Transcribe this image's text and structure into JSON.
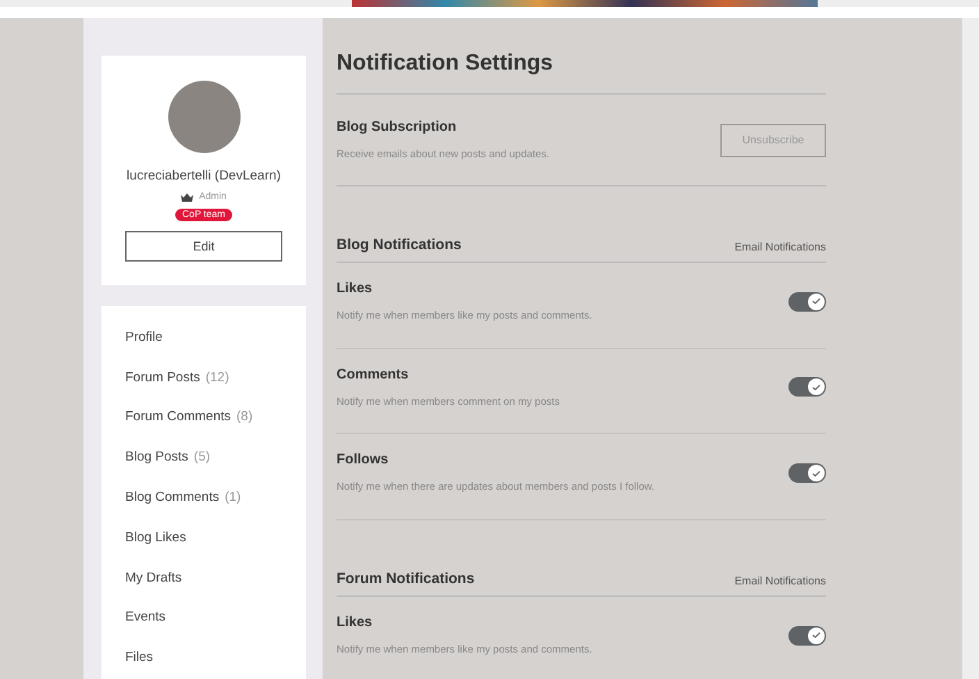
{
  "profile": {
    "username": "lucreciabertelli (DevLearn)",
    "role": "Admin",
    "badge": "CoP team",
    "edit_button": "Edit"
  },
  "nav": [
    {
      "label": "Profile"
    },
    {
      "label": "Forum Posts",
      "count": "(12)"
    },
    {
      "label": "Forum Comments",
      "count": "(8)"
    },
    {
      "label": "Blog Posts",
      "count": "(5)"
    },
    {
      "label": "Blog Comments",
      "count": "(1)"
    },
    {
      "label": "Blog Likes"
    },
    {
      "label": "My Drafts"
    },
    {
      "label": "Events"
    },
    {
      "label": "Files"
    }
  ],
  "title": "Notification Settings",
  "subscription": {
    "title": "Blog Subscription",
    "description": "Receive emails about new posts and updates.",
    "button": "Unsubscribe"
  },
  "groups": [
    {
      "title": "Blog Notifications",
      "column_label": "Email Notifications",
      "items": [
        {
          "title": "Likes",
          "description": "Notify me when members like my posts and comments.",
          "on": true
        },
        {
          "title": "Comments",
          "description": "Notify me when members comment on my posts",
          "on": true
        },
        {
          "title": "Follows",
          "description": "Notify me when there are updates about members and posts I follow.",
          "on": true
        }
      ]
    },
    {
      "title": "Forum Notifications",
      "column_label": "Email Notifications",
      "items": [
        {
          "title": "Likes",
          "description": "Notify me when members like my posts and comments.",
          "on": true
        }
      ]
    }
  ]
}
